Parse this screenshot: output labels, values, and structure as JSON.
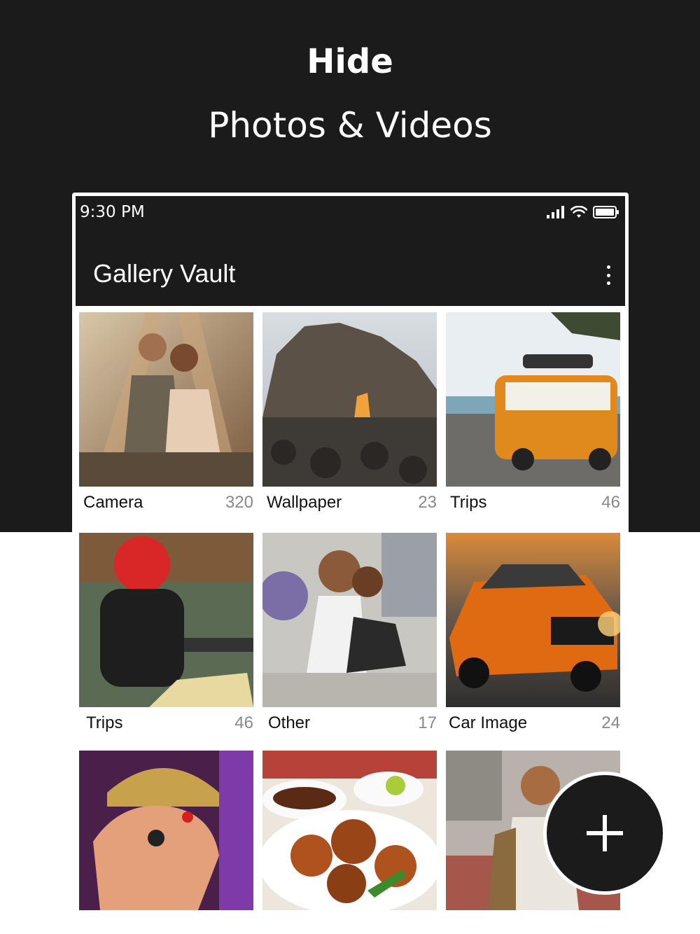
{
  "promo": {
    "title": "Hide",
    "subtitle": "Photos & Videos"
  },
  "status_bar": {
    "time": "9:30 PM"
  },
  "app_bar": {
    "title": "Gallery Vault"
  },
  "albums": [
    {
      "name": "Camera",
      "count": "320"
    },
    {
      "name": "Wallpaper",
      "count": "23"
    },
    {
      "name": "Trips",
      "count": "46"
    },
    {
      "name": "Trips",
      "count": "46"
    },
    {
      "name": "Other",
      "count": "17"
    },
    {
      "name": "Car Image",
      "count": "24"
    },
    {
      "name": "",
      "count": ""
    },
    {
      "name": "",
      "count": ""
    },
    {
      "name": "",
      "count": ""
    }
  ],
  "icons": {
    "menu": "more-vert-icon",
    "signal": "signal-icon",
    "wifi": "wifi-icon",
    "battery": "battery-icon",
    "fab": "plus-icon"
  },
  "colors": {
    "dark": "#1b1b1b",
    "text": "#111111",
    "count": "#888888"
  }
}
